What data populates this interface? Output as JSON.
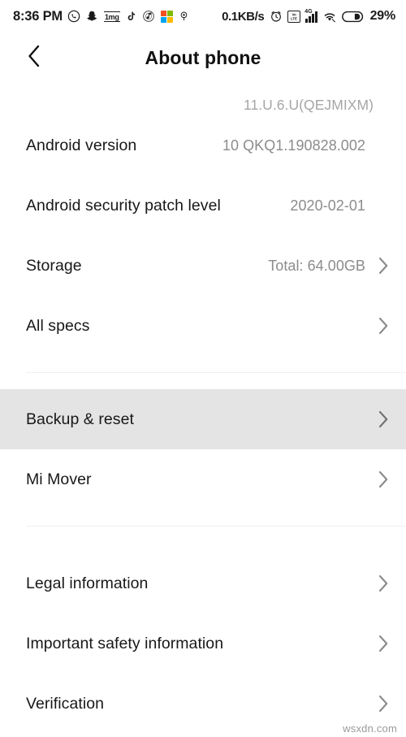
{
  "status_bar": {
    "time": "8:36 PM",
    "network_speed": "0.1KB/s",
    "battery_percent": "29%",
    "signal_generation": "4G",
    "volte_label": "VoLTE",
    "app_badge_1mg": "1mg",
    "icons": [
      "whatsapp-icon",
      "snapchat-icon",
      "onemg-icon",
      "tiktok-icon",
      "music-target-icon",
      "microsoft-icon",
      "location-pin-icon",
      "alarm-clock-icon",
      "volte-icon",
      "signal-bars-icon",
      "wifi-icon",
      "battery-icon"
    ]
  },
  "header": {
    "title": "About phone",
    "back_icon": "chevron-left-icon"
  },
  "list": {
    "rows": [
      {
        "label": "",
        "value": "11.U.6.U(QEJMIXM)",
        "chevron": false,
        "highlight": false,
        "clipped": true
      },
      {
        "label": "Android version",
        "value": "10 QKQ1.190828.002",
        "chevron": false,
        "highlight": false
      },
      {
        "label": "Android security patch level",
        "value": "2020-02-01",
        "chevron": false,
        "highlight": false
      },
      {
        "label": "Storage",
        "value": "Total: 64.00GB",
        "chevron": true,
        "highlight": false
      },
      {
        "label": "All specs",
        "value": "",
        "chevron": true,
        "highlight": false
      },
      {
        "label": "Backup & reset",
        "value": "",
        "chevron": true,
        "highlight": true
      },
      {
        "label": "Mi Mover",
        "value": "",
        "chevron": true,
        "highlight": false
      },
      {
        "label": "Legal information",
        "value": "",
        "chevron": true,
        "highlight": false
      },
      {
        "label": "Important safety information",
        "value": "",
        "chevron": true,
        "highlight": false
      },
      {
        "label": "Verification",
        "value": "",
        "chevron": true,
        "highlight": false
      }
    ]
  },
  "watermark": "wsxdn.com",
  "colors": {
    "background": "#ffffff",
    "label_text": "#18181a",
    "value_text": "#8c8c8e",
    "divider": "#f0f0f0",
    "highlight_row": "#e4e4e4",
    "chevron": "#8a8a8c"
  }
}
